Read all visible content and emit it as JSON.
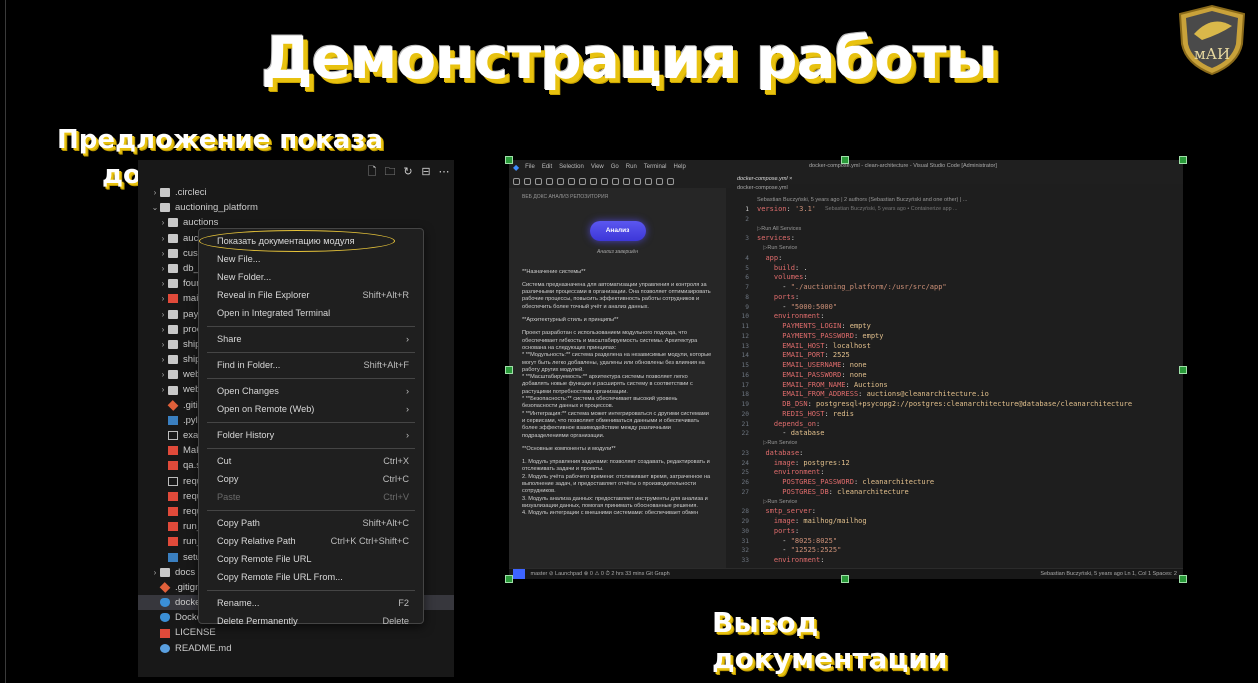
{
  "slide": {
    "title": "Демонстрация работы",
    "caption_left_line1": "Предложение показа",
    "caption_left_line2": "документации",
    "caption_right_line1": "Вывод",
    "caption_right_line2": "документации",
    "logo_text": "мАИ"
  },
  "explorer": {
    "toolbar_icons": [
      "new-file-icon",
      "new-folder-icon",
      "refresh-icon",
      "collapse-icon",
      "more-icon"
    ],
    "tree": [
      {
        "label": ".circleci",
        "kind": "folder",
        "indent": 1,
        "chev": "›"
      },
      {
        "label": "auctioning_platform",
        "kind": "folder",
        "indent": 1,
        "chev": "⌄"
      },
      {
        "label": "auctions",
        "kind": "folder",
        "indent": 2,
        "chev": "›"
      },
      {
        "label": "auctions_infrastructure",
        "kind": "folder",
        "indent": 2,
        "chev": "›"
      },
      {
        "label": "customer_relationship",
        "kind": "folder",
        "indent": 2,
        "chev": "›"
      },
      {
        "label": "db_infrastructure",
        "kind": "folder",
        "indent": 2,
        "chev": "›"
      },
      {
        "label": "foundation",
        "kind": "folder",
        "indent": 2,
        "chev": "›"
      },
      {
        "label": "main",
        "kind": "red",
        "indent": 2,
        "chev": "›"
      },
      {
        "label": "payments",
        "kind": "folder",
        "indent": 2,
        "chev": "›"
      },
      {
        "label": "processes",
        "kind": "folder",
        "indent": 2,
        "chev": "›"
      },
      {
        "label": "shipping",
        "kind": "folder",
        "indent": 2,
        "chev": "›"
      },
      {
        "label": "shipping_infrastructure",
        "kind": "folder",
        "indent": 2,
        "chev": "›"
      },
      {
        "label": "web_app",
        "kind": "folder",
        "indent": 2,
        "chev": "›"
      },
      {
        "label": "web_app_models",
        "kind": "folder",
        "indent": 2,
        "chev": "›"
      },
      {
        "label": ".gitignore",
        "kind": "git",
        "indent": 2,
        "chev": ""
      },
      {
        "label": ".pylintrc",
        "kind": "py",
        "indent": 2,
        "chev": ""
      },
      {
        "label": "example.env",
        "kind": "doc",
        "indent": 2,
        "chev": ""
      },
      {
        "label": "Makefile",
        "kind": "red",
        "indent": 2,
        "chev": ""
      },
      {
        "label": "qa.sh",
        "kind": "red",
        "indent": 2,
        "chev": ""
      },
      {
        "label": "requirements.txt",
        "kind": "doc",
        "indent": 2,
        "chev": ""
      },
      {
        "label": "requirements-dev.txt",
        "kind": "red",
        "indent": 2,
        "chev": ""
      },
      {
        "label": "requirements-test.txt",
        "kind": "red",
        "indent": 2,
        "chev": ""
      },
      {
        "label": "run_celery.py",
        "kind": "red",
        "indent": 2,
        "chev": ""
      },
      {
        "label": "run_web.py",
        "kind": "red",
        "indent": 2,
        "chev": ""
      },
      {
        "label": "setup.py",
        "kind": "py",
        "indent": 2,
        "chev": ""
      },
      {
        "label": "docs",
        "kind": "folder",
        "indent": 1,
        "chev": "›"
      },
      {
        "label": ".gitignore",
        "kind": "git",
        "indent": 1,
        "chev": ""
      },
      {
        "label": "docker-compose.yml",
        "kind": "whale",
        "indent": 1,
        "chev": "",
        "selected": true
      },
      {
        "label": "Dockerfile",
        "kind": "whale",
        "indent": 1,
        "chev": ""
      },
      {
        "label": "LICENSE",
        "kind": "red",
        "indent": 1,
        "chev": ""
      },
      {
        "label": "README.md",
        "kind": "md",
        "indent": 1,
        "chev": ""
      }
    ],
    "context_menu": [
      {
        "label": "Показать документацию модуля",
        "kb": "",
        "hl": true
      },
      {
        "label": "New File...",
        "kb": ""
      },
      {
        "label": "New Folder...",
        "kb": ""
      },
      {
        "label": "Reveal in File Explorer",
        "kb": "Shift+Alt+R"
      },
      {
        "label": "Open in Integrated Terminal",
        "kb": ""
      },
      {
        "sep": true
      },
      {
        "label": "Share",
        "kb": "›"
      },
      {
        "sep": true
      },
      {
        "label": "Find in Folder...",
        "kb": "Shift+Alt+F"
      },
      {
        "sep": true
      },
      {
        "label": "Open Changes",
        "kb": "›"
      },
      {
        "label": "Open on Remote (Web)",
        "kb": "›"
      },
      {
        "sep": true
      },
      {
        "label": "Folder History",
        "kb": "›"
      },
      {
        "sep": true
      },
      {
        "label": "Cut",
        "kb": "Ctrl+X"
      },
      {
        "label": "Copy",
        "kb": "Ctrl+C"
      },
      {
        "label": "Paste",
        "kb": "Ctrl+V",
        "disabled": true
      },
      {
        "sep": true
      },
      {
        "label": "Copy Path",
        "kb": "Shift+Alt+C"
      },
      {
        "label": "Copy Relative Path",
        "kb": "Ctrl+K Ctrl+Shift+C"
      },
      {
        "label": "Copy Remote File URL",
        "kb": ""
      },
      {
        "label": "Copy Remote File URL From...",
        "kb": ""
      },
      {
        "sep": true
      },
      {
        "label": "Rename...",
        "kb": "F2"
      },
      {
        "label": "Delete Permanently",
        "kb": "Delete"
      }
    ]
  },
  "vscode": {
    "menu": [
      "File",
      "Edit",
      "Selection",
      "View",
      "Go",
      "Run",
      "Terminal",
      "Help"
    ],
    "window_title": "docker-compose.yml - clean-architecture - Visual Studio Code [Administrator]",
    "panel_header": "ВЕБ ДОКС АНАЛИЗ РЕПОЗИТОРИЯ",
    "analyze_button": "Анализ",
    "analyze_done": "Анализ завершён",
    "doc_paragraphs": [
      "**Назначение системы**",
      "Система предназначена для автоматизации управления и контроля за различными процессами в организации. Она позволяет оптимизировать рабочие процессы, повысить эффективность работы сотрудников и обеспечить более точный учёт и анализ данных.",
      "**Архитектурный стиль и принципы**",
      "Проект разработан с использованием модульного подхода, что обеспечивает гибкость и масштабируемость системы. Архитектура основана на следующих принципах:\n* **Модульность:** система разделена на независимые модули, которые могут быть легко добавлены, удалены или обновлены без влияния на работу других модулей.\n* **Масштабируемость:** архитектура системы позволяет легко добавлять новые функции и расширять систему в соответствии с растущими потребностями организации.\n* **Безопасность:** система обеспечивает высокий уровень безопасности данных и процессов.\n* **Интеграция:** система может интегрироваться с другими системами и сервисами, что позволяет обмениваться данными и обеспечивать более эффективное взаимодействие между различными подразделениями организации.",
      "**Основные компоненты и модули**",
      "1. Модуль управления задачами: позволяет создавать, редактировать и отслеживать задачи и проекты.\n2. Модуль учёта рабочего времени: отслеживает время, затраченное на выполнение задач, и предоставляет отчёты о производительности сотрудников.\n3. Модуль анализа данных: предоставляет инструменты для анализа и визуализации данных, помогая принимать обоснованные решения.\n4. Модуль интеграции с внешними системами: обеспечивает обмен"
    ],
    "tab": "docker-compose.yml",
    "breadcrumb": "docker-compose.yml",
    "blame_header": "Sebastian Buczyński, 5 years ago | 2 authors (Sebastian Buczyński and one other) | ...",
    "code_lines": [
      {
        "n": "1",
        "segs": [
          {
            "c": "key",
            "t": "version"
          },
          {
            "c": "",
            "t": ": "
          },
          {
            "c": "str",
            "t": "'3.1'"
          },
          {
            "c": "dim",
            "t": "      Sebastian Buczyński, 5 years ago • Containerize app ..."
          }
        ]
      },
      {
        "n": "2",
        "segs": []
      },
      {
        "n": "",
        "segs": [
          {
            "c": "hint",
            "t": "▷Run All Services"
          }
        ]
      },
      {
        "n": "3",
        "segs": [
          {
            "c": "key",
            "t": "services"
          },
          {
            "c": "",
            "t": ":"
          }
        ]
      },
      {
        "n": "",
        "segs": [
          {
            "c": "hint",
            "t": "    ▷Run Service"
          }
        ]
      },
      {
        "n": "4",
        "segs": [
          {
            "c": "",
            "t": "  "
          },
          {
            "c": "key",
            "t": "app"
          },
          {
            "c": "",
            "t": ":"
          }
        ]
      },
      {
        "n": "5",
        "segs": [
          {
            "c": "",
            "t": "    "
          },
          {
            "c": "key",
            "t": "build"
          },
          {
            "c": "",
            "t": ": ."
          }
        ]
      },
      {
        "n": "6",
        "segs": [
          {
            "c": "",
            "t": "    "
          },
          {
            "c": "key",
            "t": "volumes"
          },
          {
            "c": "",
            "t": ":"
          }
        ]
      },
      {
        "n": "7",
        "segs": [
          {
            "c": "",
            "t": "      - "
          },
          {
            "c": "str",
            "t": "\"./auctioning_platform/:/usr/src/app\""
          }
        ]
      },
      {
        "n": "8",
        "segs": [
          {
            "c": "",
            "t": "    "
          },
          {
            "c": "key",
            "t": "ports"
          },
          {
            "c": "",
            "t": ":"
          }
        ]
      },
      {
        "n": "9",
        "segs": [
          {
            "c": "",
            "t": "      - "
          },
          {
            "c": "str",
            "t": "\"5000:5000\""
          }
        ]
      },
      {
        "n": "10",
        "segs": [
          {
            "c": "",
            "t": "    "
          },
          {
            "c": "key",
            "t": "environment"
          },
          {
            "c": "",
            "t": ":"
          }
        ]
      },
      {
        "n": "11",
        "segs": [
          {
            "c": "",
            "t": "      "
          },
          {
            "c": "key",
            "t": "PAYMENTS_LOGIN"
          },
          {
            "c": "",
            "t": ": "
          },
          {
            "c": "val",
            "t": "empty"
          }
        ]
      },
      {
        "n": "12",
        "segs": [
          {
            "c": "",
            "t": "      "
          },
          {
            "c": "key",
            "t": "PAYMENTS_PASSWORD"
          },
          {
            "c": "",
            "t": ": "
          },
          {
            "c": "val",
            "t": "empty"
          }
        ]
      },
      {
        "n": "13",
        "segs": [
          {
            "c": "",
            "t": "      "
          },
          {
            "c": "key",
            "t": "EMAIL_HOST"
          },
          {
            "c": "",
            "t": ": "
          },
          {
            "c": "val",
            "t": "localhost"
          }
        ]
      },
      {
        "n": "14",
        "segs": [
          {
            "c": "",
            "t": "      "
          },
          {
            "c": "key",
            "t": "EMAIL_PORT"
          },
          {
            "c": "",
            "t": ": "
          },
          {
            "c": "val",
            "t": "2525"
          }
        ]
      },
      {
        "n": "15",
        "segs": [
          {
            "c": "",
            "t": "      "
          },
          {
            "c": "key",
            "t": "EMAIL_USERNAME"
          },
          {
            "c": "",
            "t": ": "
          },
          {
            "c": "val",
            "t": "none"
          }
        ]
      },
      {
        "n": "16",
        "segs": [
          {
            "c": "",
            "t": "      "
          },
          {
            "c": "key",
            "t": "EMAIL_PASSWORD"
          },
          {
            "c": "",
            "t": ": "
          },
          {
            "c": "val",
            "t": "none"
          }
        ]
      },
      {
        "n": "17",
        "segs": [
          {
            "c": "",
            "t": "      "
          },
          {
            "c": "key",
            "t": "EMAIL_FROM_NAME"
          },
          {
            "c": "",
            "t": ": "
          },
          {
            "c": "val",
            "t": "Auctions"
          }
        ]
      },
      {
        "n": "18",
        "segs": [
          {
            "c": "",
            "t": "      "
          },
          {
            "c": "key",
            "t": "EMAIL_FROM_ADDRESS"
          },
          {
            "c": "",
            "t": ": "
          },
          {
            "c": "val",
            "t": "auctions@cleanarchitecture.io"
          }
        ]
      },
      {
        "n": "19",
        "segs": [
          {
            "c": "",
            "t": "      "
          },
          {
            "c": "key",
            "t": "DB_DSN"
          },
          {
            "c": "",
            "t": ": "
          },
          {
            "c": "val",
            "t": "postgresql+psycopg2://postgres:cleanarchitecture@database/cleanarchitecture"
          }
        ]
      },
      {
        "n": "20",
        "segs": [
          {
            "c": "",
            "t": "      "
          },
          {
            "c": "key",
            "t": "REDIS_HOST"
          },
          {
            "c": "",
            "t": ": "
          },
          {
            "c": "val",
            "t": "redis"
          }
        ]
      },
      {
        "n": "21",
        "segs": [
          {
            "c": "",
            "t": "    "
          },
          {
            "c": "key",
            "t": "depends_on"
          },
          {
            "c": "",
            "t": ":"
          }
        ]
      },
      {
        "n": "22",
        "segs": [
          {
            "c": "",
            "t": "      - "
          },
          {
            "c": "val",
            "t": "database"
          }
        ]
      },
      {
        "n": "",
        "segs": [
          {
            "c": "hint",
            "t": "    ▷Run Service"
          }
        ]
      },
      {
        "n": "23",
        "segs": [
          {
            "c": "",
            "t": "  "
          },
          {
            "c": "key",
            "t": "database"
          },
          {
            "c": "",
            "t": ":"
          }
        ]
      },
      {
        "n": "24",
        "segs": [
          {
            "c": "",
            "t": "    "
          },
          {
            "c": "key",
            "t": "image"
          },
          {
            "c": "",
            "t": ": "
          },
          {
            "c": "val",
            "t": "postgres:12"
          }
        ]
      },
      {
        "n": "25",
        "segs": [
          {
            "c": "",
            "t": "    "
          },
          {
            "c": "key",
            "t": "environment"
          },
          {
            "c": "",
            "t": ":"
          }
        ]
      },
      {
        "n": "26",
        "segs": [
          {
            "c": "",
            "t": "      "
          },
          {
            "c": "key",
            "t": "POSTGRES_PASSWORD"
          },
          {
            "c": "",
            "t": ": "
          },
          {
            "c": "val",
            "t": "cleanarchitecture"
          }
        ]
      },
      {
        "n": "27",
        "segs": [
          {
            "c": "",
            "t": "      "
          },
          {
            "c": "key",
            "t": "POSTGRES_DB"
          },
          {
            "c": "",
            "t": ": "
          },
          {
            "c": "val",
            "t": "cleanarchitecture"
          }
        ]
      },
      {
        "n": "",
        "segs": [
          {
            "c": "hint",
            "t": "    ▷Run Service"
          }
        ]
      },
      {
        "n": "28",
        "segs": [
          {
            "c": "",
            "t": "  "
          },
          {
            "c": "key",
            "t": "smtp_server"
          },
          {
            "c": "",
            "t": ":"
          }
        ]
      },
      {
        "n": "29",
        "segs": [
          {
            "c": "",
            "t": "    "
          },
          {
            "c": "key",
            "t": "image"
          },
          {
            "c": "",
            "t": ": "
          },
          {
            "c": "val",
            "t": "mailhog/mailhog"
          }
        ]
      },
      {
        "n": "30",
        "segs": [
          {
            "c": "",
            "t": "    "
          },
          {
            "c": "key",
            "t": "ports"
          },
          {
            "c": "",
            "t": ":"
          }
        ]
      },
      {
        "n": "31",
        "segs": [
          {
            "c": "",
            "t": "      - "
          },
          {
            "c": "str",
            "t": "\"8025:8025\""
          }
        ]
      },
      {
        "n": "32",
        "segs": [
          {
            "c": "",
            "t": "      - "
          },
          {
            "c": "str",
            "t": "\"12525:2525\""
          }
        ]
      },
      {
        "n": "33",
        "segs": [
          {
            "c": "",
            "t": "    "
          },
          {
            "c": "key",
            "t": "environment"
          },
          {
            "c": "",
            "t": ":"
          }
        ]
      }
    ],
    "status_left": "master  ⊘  Launchpad  ⊗ 0 ⚠ 0   ⏱ 2 hrs 33 mins   Git Graph",
    "status_right": "Sebastian Buczyński, 5 years ago    Ln 1, Col 1    Spaces: 2"
  }
}
